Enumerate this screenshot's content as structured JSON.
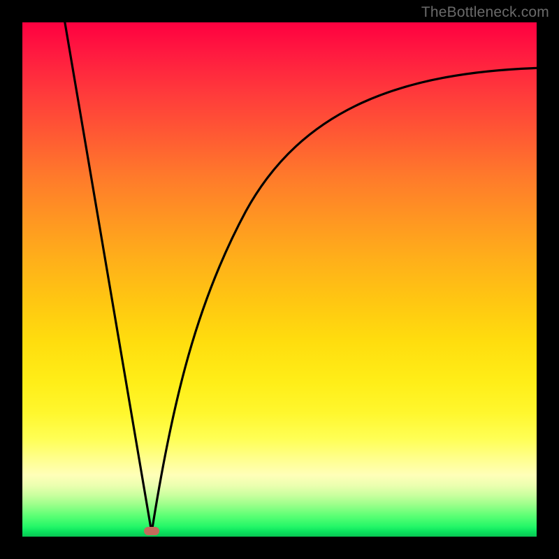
{
  "watermark": {
    "text": "TheBottleneck.com"
  },
  "chart_data": {
    "type": "line",
    "title": "",
    "xlabel": "",
    "ylabel": "",
    "x_range": [
      0,
      100
    ],
    "y_range": [
      0,
      100
    ],
    "grid": false,
    "legend": false,
    "background_gradient": {
      "top": "#ff0040",
      "middle": "#ffdd0e",
      "bottom": "#08c653"
    },
    "minimum_marker": {
      "x": 25,
      "y": 0,
      "color": "#c46b5c"
    },
    "series": [
      {
        "name": "left-branch",
        "x": [
          8,
          10,
          12,
          14,
          16,
          18,
          20,
          22,
          24,
          25
        ],
        "y": [
          100,
          88,
          77,
          65,
          53,
          42,
          30,
          18,
          6,
          0
        ]
      },
      {
        "name": "right-branch",
        "x": [
          25,
          26,
          27,
          28,
          30,
          32,
          35,
          38,
          42,
          47,
          53,
          60,
          68,
          78,
          88,
          100
        ],
        "y": [
          0,
          8,
          15,
          21,
          32,
          41,
          51,
          58,
          65,
          71,
          76,
          80,
          83,
          86,
          88,
          90
        ]
      }
    ]
  }
}
